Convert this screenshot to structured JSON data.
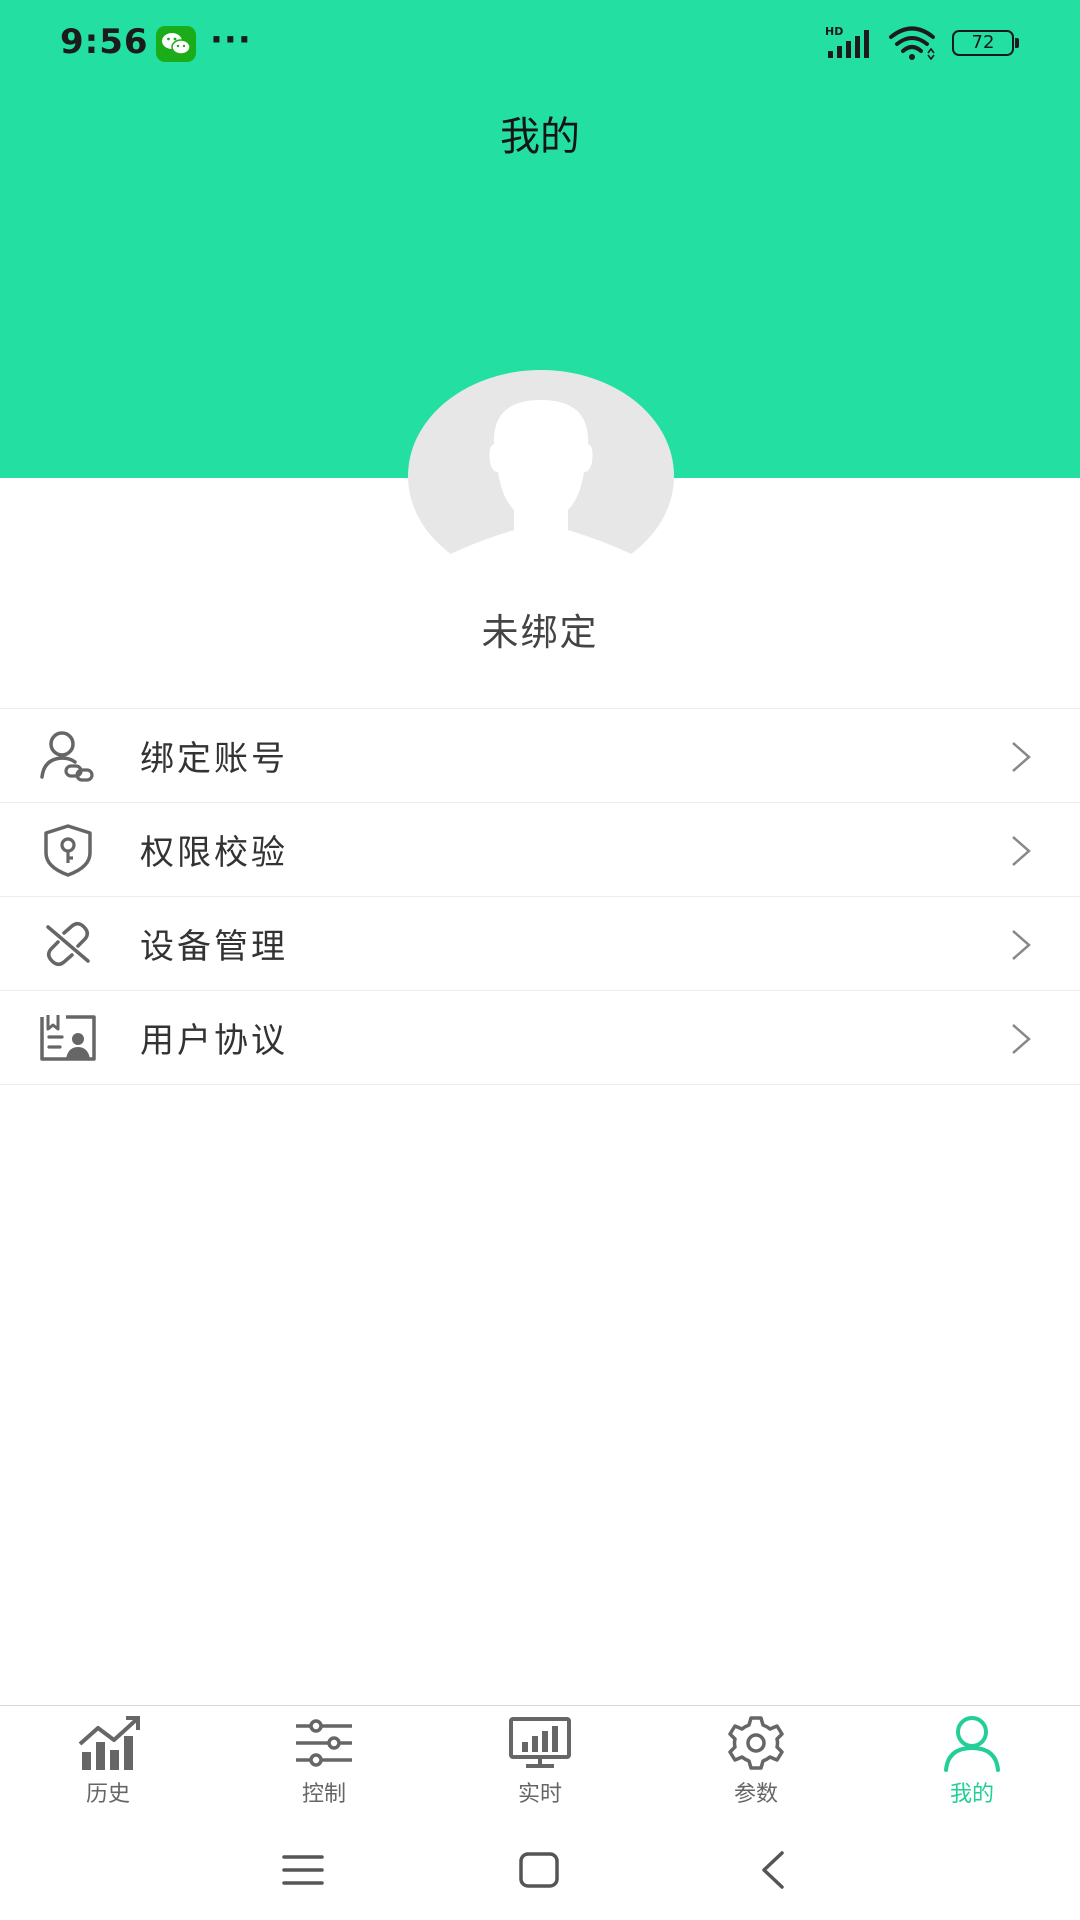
{
  "status_bar": {
    "time": "9:56",
    "more": "···",
    "battery": "72"
  },
  "header": {
    "title": "我的"
  },
  "profile": {
    "status": "未绑定"
  },
  "menu": {
    "items": [
      {
        "label": "绑定账号",
        "icon": "user-link-icon"
      },
      {
        "label": "权限校验",
        "icon": "shield-key-icon"
      },
      {
        "label": "设备管理",
        "icon": "broken-link-icon"
      },
      {
        "label": "用户协议",
        "icon": "agreement-card-icon"
      }
    ]
  },
  "tabs": {
    "items": [
      {
        "label": "历史",
        "icon": "history-chart-icon"
      },
      {
        "label": "控制",
        "icon": "sliders-icon"
      },
      {
        "label": "实时",
        "icon": "monitor-chart-icon"
      },
      {
        "label": "参数",
        "icon": "gear-icon"
      },
      {
        "label": "我的",
        "icon": "user-icon"
      }
    ],
    "active_index": 4
  },
  "colors": {
    "accent": "#23e0a2",
    "accent_text": "#23cf98",
    "icon_gray": "#666666",
    "text": "#333333"
  }
}
